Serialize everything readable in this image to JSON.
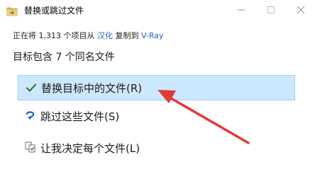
{
  "window": {
    "title": "替换或跳过文件",
    "icons": {
      "app": "folder-transfer-icon",
      "minimize": "minimize-icon",
      "maximize": "maximize-icon",
      "close": "close-icon"
    }
  },
  "info": {
    "prefix": "正在将 1,313 个项目从 ",
    "source": "汉化",
    "middle": " 复制到 ",
    "destination": "V-Ray"
  },
  "heading": "目标包含 7 个同名文件",
  "options": [
    {
      "label": "替换目标中的文件(R)",
      "icon": "checkmark-icon",
      "selected": true
    },
    {
      "label": "跳过这些文件(S)",
      "icon": "skip-arrow-icon",
      "selected": false
    },
    {
      "label": "让我决定每个文件(L)",
      "icon": "compare-files-icon",
      "selected": false
    }
  ],
  "colors": {
    "link": "#2060b8",
    "selection_bg": "#cce8ff",
    "selection_border": "#99d1ff",
    "annotation_arrow": "#e53935",
    "check_green": "#2e7d32"
  }
}
